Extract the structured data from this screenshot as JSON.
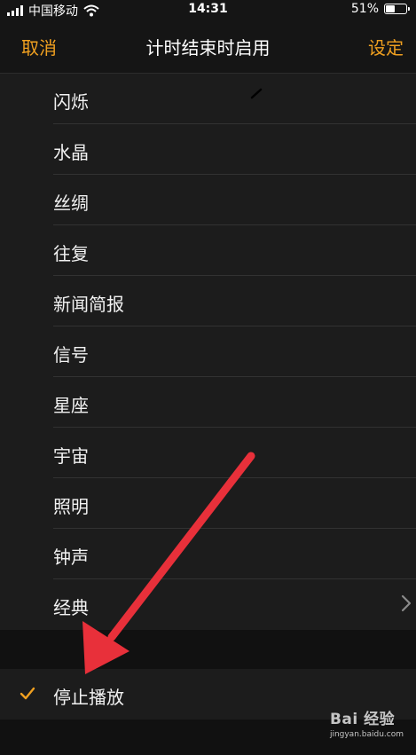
{
  "status_bar": {
    "carrier": "中国移动",
    "time": "14:31",
    "battery": "51%",
    "battery_level": 0.51,
    "icons": [
      "signal-bars-icon",
      "wifi-icon",
      "battery-icon"
    ]
  },
  "nav": {
    "cancel": "取消",
    "title": "计时结束时启用",
    "set": "设定"
  },
  "items": [
    {
      "label": "闪烁"
    },
    {
      "label": "水晶"
    },
    {
      "label": "丝绸"
    },
    {
      "label": "往复"
    },
    {
      "label": "新闻简报"
    },
    {
      "label": "信号"
    },
    {
      "label": "星座"
    },
    {
      "label": "宇宙"
    },
    {
      "label": "照明"
    },
    {
      "label": "钟声"
    },
    {
      "label": "经典",
      "has_chevron": true
    }
  ],
  "stop": {
    "label": "停止播放",
    "selected": true
  },
  "watermark": {
    "main": "Bai 经验",
    "sub": "jingyan.baidu.com"
  },
  "colors": {
    "accent": "#f0a020",
    "annotation_arrow": "#e8303a",
    "background": "#1c1c1c"
  }
}
